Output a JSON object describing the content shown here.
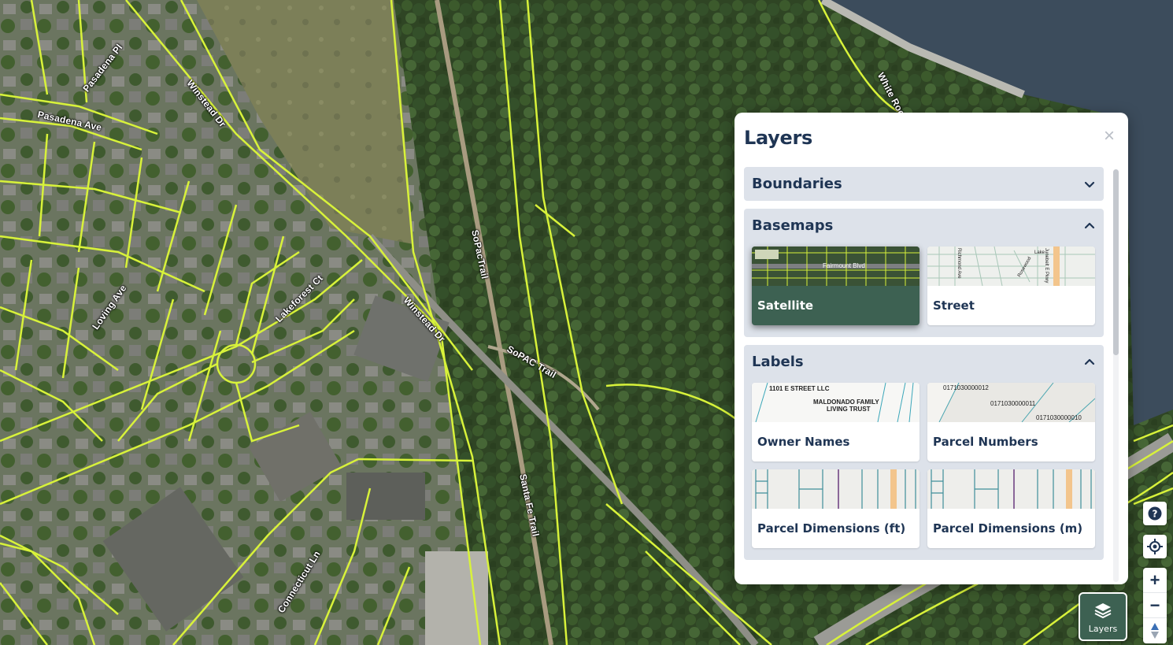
{
  "map": {
    "road_labels": [
      "Pasadena Pl",
      "Pasadena Ave",
      "Winstead Dr",
      "SoPacTrail",
      "SoPAC Trail",
      "Winstead Dr",
      "Lakeforest Ct",
      "Loving Ave",
      "Santa Fe Trail",
      "Connecticut Ln",
      "White Rock Lake"
    ],
    "parcel_color": "#d8f23a"
  },
  "layers_panel": {
    "title": "Layers",
    "close_symbol": "×",
    "sections": [
      {
        "title": "Boundaries",
        "expanded": false
      },
      {
        "title": "Basemaps",
        "expanded": true,
        "tiles": [
          {
            "label": "Satellite",
            "selected": true,
            "thumb_text": "Fairmount Blvd"
          },
          {
            "label": "Street",
            "selected": false,
            "thumb_text": [
              "Richmond Ave",
              "Rosewood",
              "Lake",
              "Junebelt E Pkwy"
            ]
          }
        ]
      },
      {
        "title": "Labels",
        "expanded": true,
        "tiles": [
          {
            "label": "Owner Names",
            "selected": false,
            "thumb_text": [
              "1101 E STREET LLC",
              "MALDONADO FAMILY",
              "LIVING TRUST"
            ]
          },
          {
            "label": "Parcel Numbers",
            "selected": false,
            "thumb_text": [
              "0171030000012",
              "0171030000011",
              "0171030000010"
            ]
          },
          {
            "label": "Parcel Dimensions (ft)",
            "selected": false
          },
          {
            "label": "Parcel Dimensions (m)",
            "selected": false
          }
        ]
      }
    ]
  },
  "controls": {
    "help_icon": "?",
    "zoom_in": "+",
    "zoom_out": "−",
    "layers_button_label": "Layers",
    "accent_color": "#3d6152"
  }
}
